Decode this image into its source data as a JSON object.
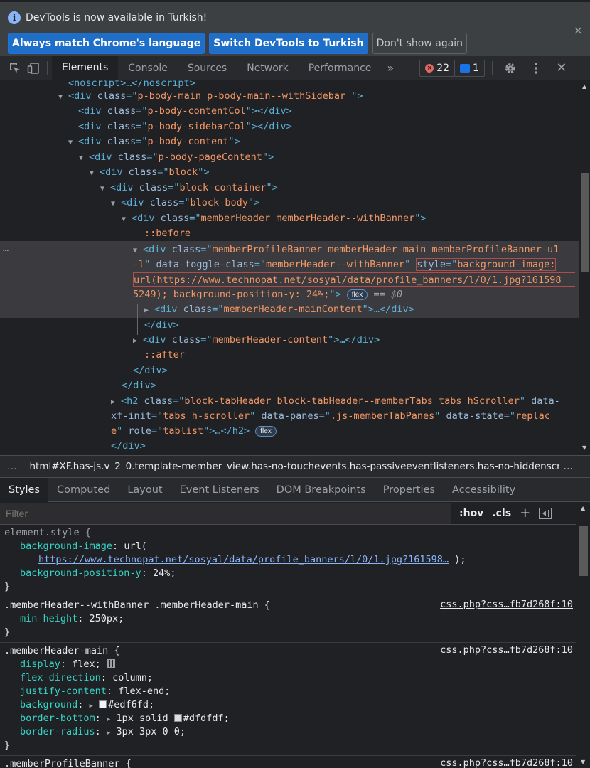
{
  "infobar": {
    "message": "DevTools is now available in Turkish!",
    "btn_match": "Always match Chrome's language",
    "btn_switch": "Switch DevTools to Turkish",
    "btn_dont": "Don't show again",
    "close": "×"
  },
  "toolbar": {
    "tabs": [
      "Elements",
      "Console",
      "Sources",
      "Network",
      "Performance"
    ],
    "more": "»",
    "errors": "22",
    "messages": "1"
  },
  "tree": {
    "l0": "<noscript>…</noscript>",
    "l1_class": "p-body-main p-body-main--withSidebar ",
    "l2_class": "p-body-contentCol",
    "l3_class": "p-body-sidebarCol",
    "l4_class": "p-body-content",
    "l5_class": "p-body-pageContent",
    "l6_class": "block",
    "l7_class": "block-container",
    "l8_class": "block-body",
    "l9_class": "memberHeader memberHeader--withBanner",
    "before": "::before",
    "sel_class_1": "memberProfileBanner memberHeader-main memberProfileBanner-u1",
    "sel_class_2": "-l",
    "sel_toggle": "memberHeader--withBanner",
    "sel_style_1": "background-image:",
    "sel_style_2": "url(https://www.technopat.net/sosyal/data/profile_banners/l/0/1.jpg?161598",
    "sel_style_3": "5249); background-position-y: 24%;",
    "flex": "flex",
    "dollar": "== $0",
    "mc_class": "memberHeader-mainContent",
    "hc_class": "memberHeader-content",
    "after": "::after",
    "h2_class_1": "block-tabHeader block-tabHeader--memberTabs tabs hScroller",
    "h2_2a": "xf-init=",
    "h2_init": "tabs h-scroller",
    "h2_2b": " data-panes=",
    "h2_panes": ".js-memberTabPanes",
    "h2_2c": " data-state=",
    "h2_state_1": "replac",
    "h2_state_2": "e",
    "h2_role": "tablist"
  },
  "breadcrumb": "html#XF.has-js.v_2_0.template-member_view.has-no-touchevents.has-passiveeventlisteners.has-no-hiddenscroll",
  "subtabs": [
    "Styles",
    "Computed",
    "Layout",
    "Event Listeners",
    "DOM Breakpoints",
    "Properties",
    "Accessibility"
  ],
  "filter": {
    "placeholder": "Filter",
    "hov": ":hov",
    "cls": ".cls",
    "plus": "+"
  },
  "styles": {
    "r1_sel": "element.style {",
    "r1_p1": "background-image",
    "r1_v1": "url(",
    "r1_url": "https://www.technopat.net/sosyal/data/profile_banners/l/0/1.jpg?161598…",
    "r1_v1end": ");",
    "r1_p2": "background-position-y",
    "r1_v2": "24%;",
    "r2_sel": ".memberHeader--withBanner .memberHeader-main {",
    "r2_src": "css.php?css…fb7d268f:10",
    "r2_p1": "min-height",
    "r2_v1": "250px;",
    "r3_sel": ".memberHeader-main {",
    "r3_src": "css.php?css…fb7d268f:10",
    "r3_p1": "display",
    "r3_v1": "flex;",
    "r3_p2": "flex-direction",
    "r3_v2": "column;",
    "r3_p3": "justify-content",
    "r3_v3": "flex-end;",
    "r3_p4": "background",
    "r3_v4": "#edf6fd;",
    "r3_p5": "border-bottom",
    "r3_v5a": "1px solid ",
    "r3_v5b": "#dfdfdf;",
    "r3_p6": "border-radius",
    "r3_v6": "3px 3px 0 0;",
    "close": "}",
    "r4_sel": ".memberProfileBanner {",
    "r4_src": "css.php?css…fb7d268f:10"
  },
  "colors": {
    "swatch_bg": "#edf6fd",
    "swatch_border": "#dfdfdf"
  }
}
